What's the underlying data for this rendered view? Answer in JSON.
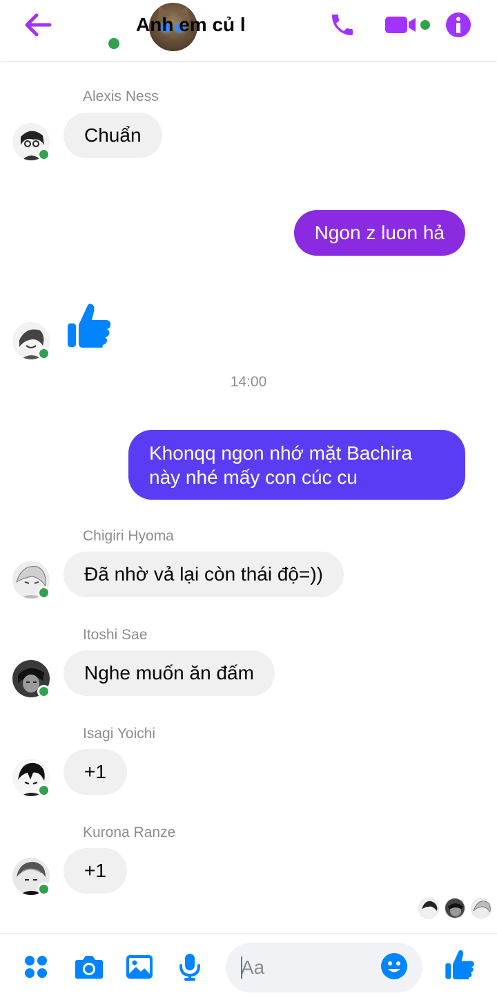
{
  "header": {
    "title": "Anh em củ l",
    "back_icon": "arrow-left-icon",
    "call_icon": "phone-icon",
    "video_icon": "video-camera-icon",
    "info_icon": "info-icon",
    "accent_color": "#a033ff"
  },
  "messages": [
    {
      "type": "incoming",
      "sender": "Alexis Ness",
      "text": "Chuẩn"
    },
    {
      "type": "outgoing",
      "text": "Ngon z luon hả"
    },
    {
      "type": "incoming-like",
      "sender_icon": "thumbs-up-icon"
    },
    {
      "type": "timestamp",
      "text": "14:00"
    },
    {
      "type": "outgoing",
      "text": "Khonqq ngon nhớ mặt Bachira\nnày nhé mấy con cúc cu"
    },
    {
      "type": "incoming",
      "sender": "Chigiri Hyoma",
      "text": "Đã nhờ vả lại còn thái độ=))"
    },
    {
      "type": "incoming",
      "sender": "Itoshi Sae",
      "text": "Nghe muốn ăn đấm"
    },
    {
      "type": "incoming",
      "sender": "Isagi Yoichi",
      "text": "+1"
    },
    {
      "type": "incoming",
      "sender": "Kurona Ranze",
      "text": "+1"
    }
  ],
  "composer": {
    "placeholder": "Aa",
    "value": "",
    "icons": [
      "apps-grid-icon",
      "camera-icon",
      "image-icon",
      "microphone-icon",
      "emoji-icon",
      "thumbs-up-icon"
    ],
    "icon_color": "#0084ff"
  },
  "colors": {
    "outgoing_bubble_1": "#8a2be2",
    "outgoing_bubble_2": "#5b3cf5",
    "incoming_bubble": "#f0f0f0",
    "online": "#31a24c"
  }
}
